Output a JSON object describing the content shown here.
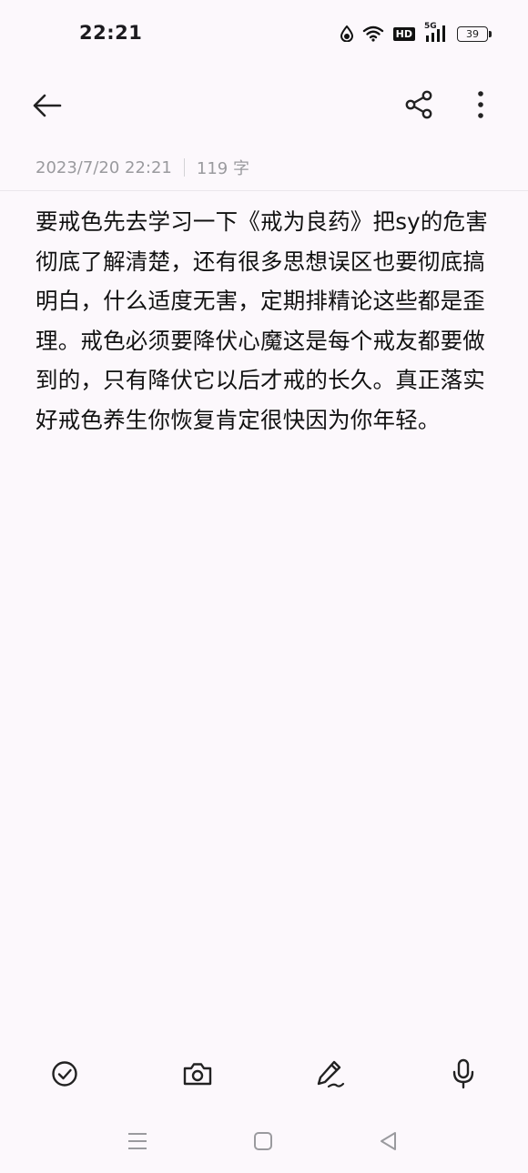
{
  "status_bar": {
    "time": "22:21",
    "icons": [
      "water-drop-icon",
      "wifi-icon",
      "hd-icon",
      "signal-5g-icon",
      "battery-icon"
    ],
    "hd_label": "HD",
    "network_label": "5G",
    "battery_level": "39"
  },
  "app_bar": {
    "back_icon": "arrow-left-icon",
    "share_icon": "share-icon",
    "more_icon": "more-vertical-icon"
  },
  "note": {
    "date": "2023/7/20 22:21",
    "char_count": "119 字",
    "body": "要戒色先去学习一下《戒为良药》把sy的危害彻底了解清楚，还有很多思想误区也要彻底搞明白，什么适度无害，定期排精论这些都是歪理。戒色必须要降伏心魔这是每个戒友都要做到的，只有降伏它以后才戒的长久。真正落实好戒色养生你恢复肯定很快因为你年轻。"
  },
  "toolbar": {
    "items": [
      "checklist-icon",
      "camera-icon",
      "pen-icon",
      "microphone-icon"
    ]
  },
  "nav_bar": {
    "items": [
      "menu-icon",
      "home-square-icon",
      "back-triangle-icon"
    ]
  },
  "colors": {
    "background": "#fcf8fc",
    "text": "#111111",
    "meta_text": "#9a9a9e"
  }
}
